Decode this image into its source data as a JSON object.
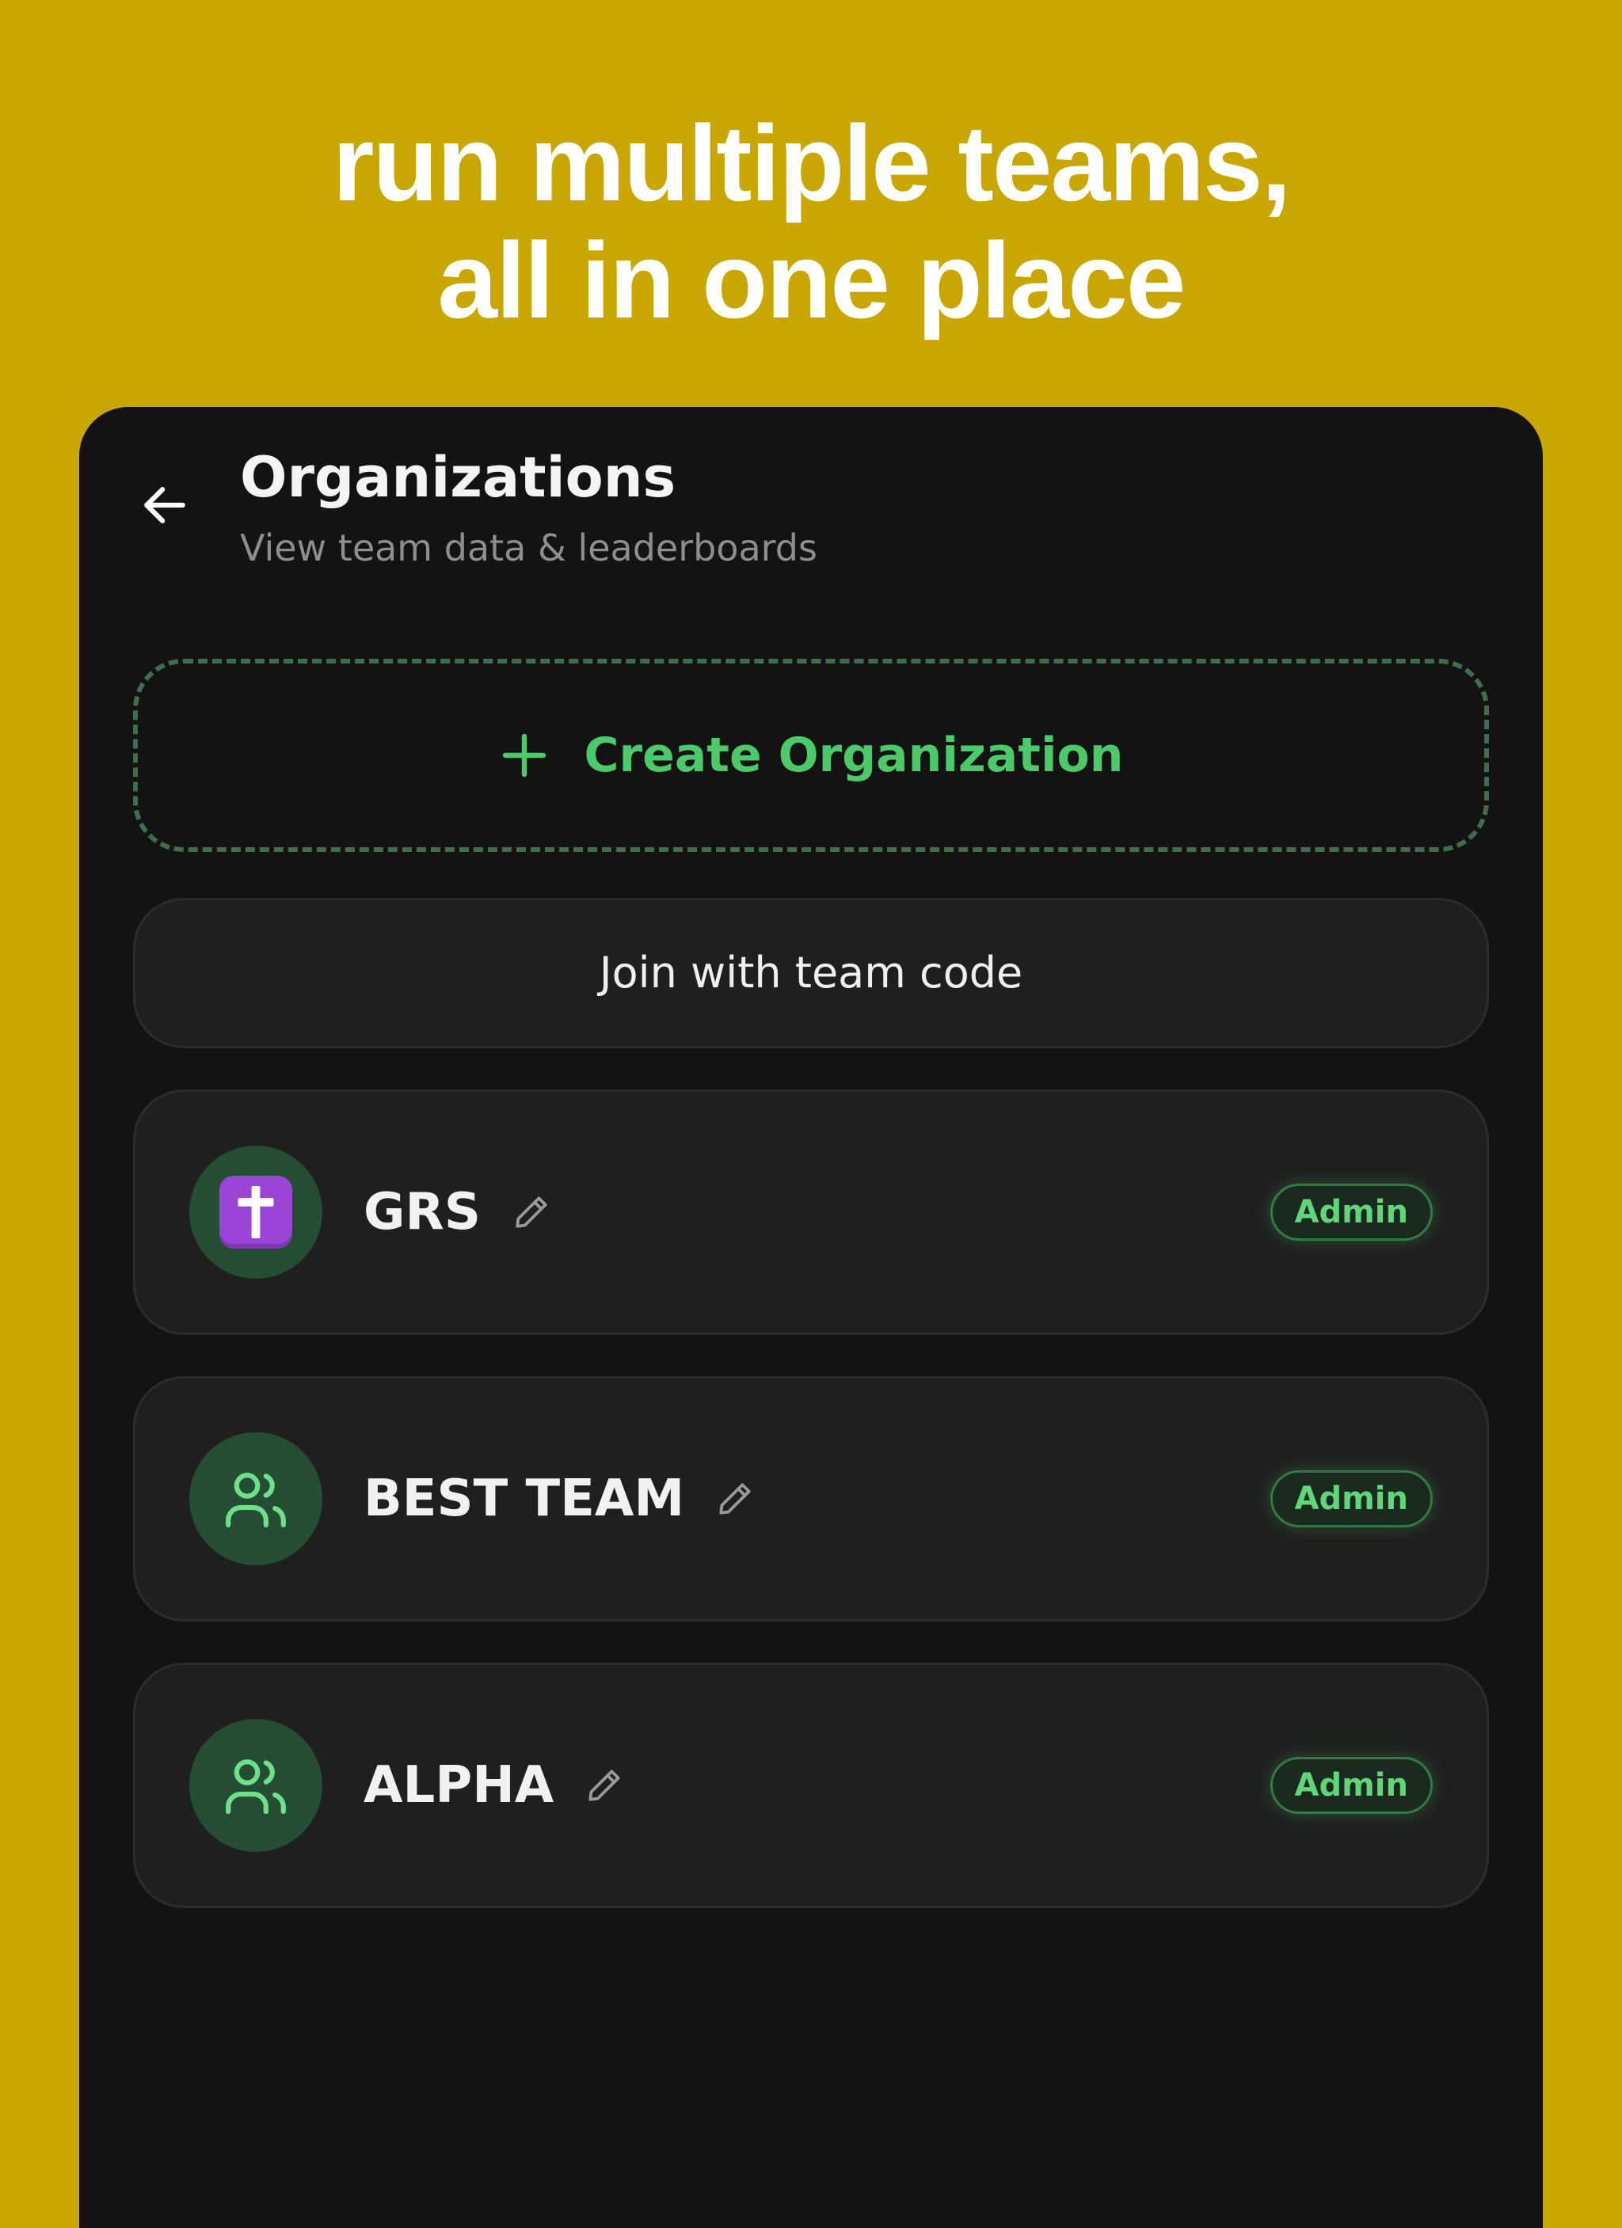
{
  "headline": {
    "line1": "run multiple teams,",
    "line2": "all in one place"
  },
  "header": {
    "back_icon": "arrow-left-icon",
    "title": "Organizations",
    "subtitle": "View team data & leaderboards"
  },
  "create_button": {
    "icon": "plus-icon",
    "label": "Create Organization"
  },
  "join_button": {
    "label": "Join with team code"
  },
  "organizations": [
    {
      "name": "GRS",
      "avatar": "latin-cross-emoji",
      "role": "Admin"
    },
    {
      "name": "BEST TEAM",
      "avatar": "users-icon",
      "role": "Admin"
    },
    {
      "name": "ALPHA",
      "avatar": "users-icon",
      "role": "Admin"
    }
  ],
  "colors": {
    "background": "#caa700",
    "surface": "#131313",
    "card": "#1f1f1f",
    "accent": "#4cc968",
    "avatar_bg": "#244d33",
    "emoji_tile": "#9b45d8"
  }
}
